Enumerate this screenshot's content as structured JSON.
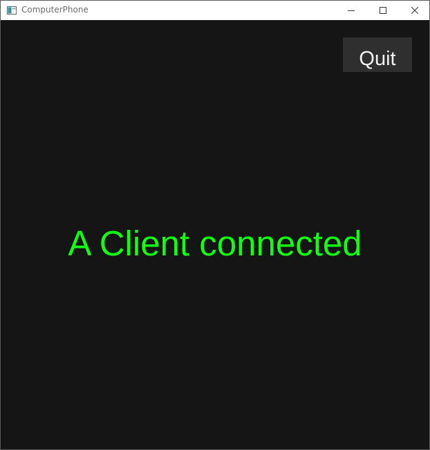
{
  "window": {
    "title": "ComputerPhone",
    "icon": "app-window-icon",
    "controls": [
      "minimize-icon",
      "maximize-icon",
      "close-icon"
    ]
  },
  "main": {
    "quit_label": "Quit",
    "status_text": "A Client connected"
  },
  "colors": {
    "background": "#151515",
    "status_text": "#13ff13",
    "quit_button_bg": "#2f2f2f",
    "quit_button_text": "#f2f2f2"
  }
}
